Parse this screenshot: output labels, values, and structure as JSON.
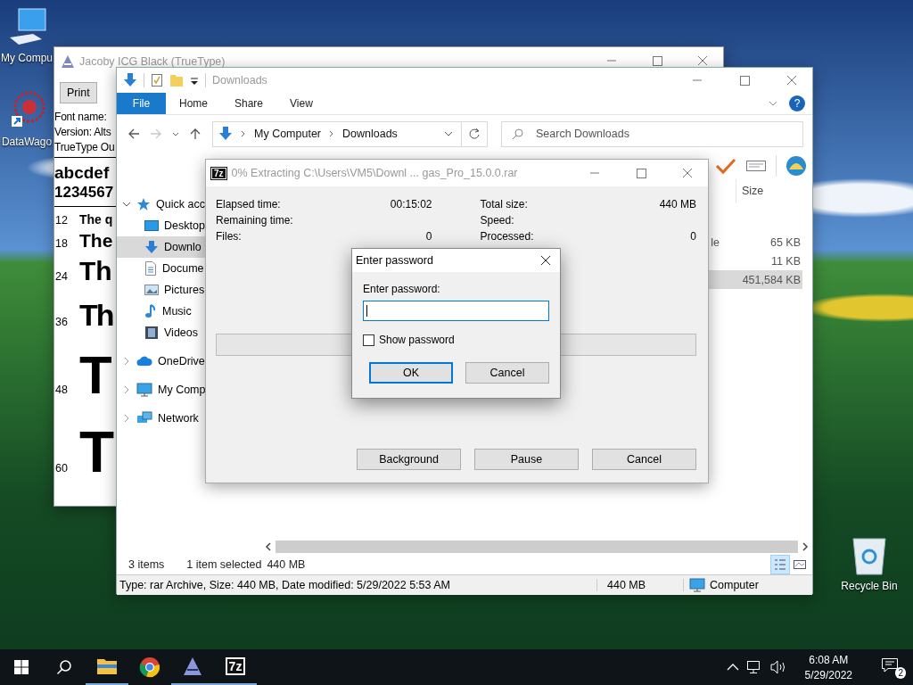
{
  "desktop": {
    "icons": [
      {
        "kind": "computer",
        "label": "My Compu"
      },
      {
        "kind": "starburst",
        "label": "DataWago"
      },
      {
        "kind": "recycle",
        "label": "Recycle Bin"
      }
    ]
  },
  "font_viewer": {
    "title": "Jacoby ICG Black (TrueType)",
    "buttons": [
      "Print"
    ],
    "info": [
      "Font name:",
      "Version: Alts",
      "TrueType Ou"
    ],
    "alphabet": "abcdef",
    "digits": "1234567",
    "samples": [
      {
        "size": "12",
        "text": "The q"
      },
      {
        "size": "18",
        "text": "The"
      },
      {
        "size": "24",
        "text": "Th"
      },
      {
        "size": "36",
        "text": "Th"
      },
      {
        "size": "48",
        "text": "T"
      },
      {
        "size": "60",
        "text": "T"
      }
    ]
  },
  "explorer": {
    "title": "Downloads",
    "ribbon_tabs": [
      {
        "label": "File",
        "kind": "menu"
      },
      {
        "label": "Home",
        "kind": "tab"
      },
      {
        "label": "Share",
        "kind": "tab"
      },
      {
        "label": "View",
        "kind": "tab"
      }
    ],
    "help": "?",
    "breadcrumb": [
      "My Computer",
      "Downloads"
    ],
    "search": {
      "placeholder": "Search Downloads"
    },
    "nav": [
      {
        "label": "Quick acc",
        "kind": "star",
        "expanded": true,
        "selected": false,
        "children": [
          {
            "label": "Desktop",
            "kind": "desktop",
            "selected": false
          },
          {
            "label": "Downlo",
            "kind": "download",
            "selected": true
          },
          {
            "label": "Docume",
            "kind": "document",
            "selected": false
          },
          {
            "label": "Pictures",
            "kind": "pictures",
            "selected": false
          },
          {
            "label": "Music",
            "kind": "music",
            "selected": false
          },
          {
            "label": "Videos",
            "kind": "videos",
            "selected": false
          }
        ]
      },
      {
        "label": "OneDrive",
        "kind": "cloud",
        "expanded": false,
        "selected": false
      },
      {
        "label": "My Comp",
        "kind": "computer",
        "expanded": false,
        "selected": false
      },
      {
        "label": "Network",
        "kind": "network",
        "expanded": false,
        "selected": false
      }
    ],
    "columns": [
      "Size"
    ],
    "rows": [
      {
        "column_1": "le",
        "size": "65 KB",
        "selected": false
      },
      {
        "size": "11 KB",
        "selected": false
      },
      {
        "size": "451,584 KB",
        "selected": true
      }
    ],
    "status": {
      "items": "3 items",
      "selection": "1 item selected",
      "selection_size": "440 MB"
    },
    "details_bar": {
      "description": "Type: rar Archive, Size: 440 MB, Date modified: 5/29/2022 5:53 AM",
      "size": "440 MB",
      "zone": "Computer"
    }
  },
  "extract": {
    "badge": "7z",
    "title": "0% Extracting C:\\Users\\VM5\\Downl ... gas_Pro_15.0.0.rar",
    "stats_left": [
      {
        "label": "Elapsed time:",
        "value": "00:15:02"
      },
      {
        "label": "Remaining time:"
      },
      {
        "label": "Files:",
        "value": "0"
      }
    ],
    "stats_right": [
      {
        "label": "Total size:",
        "value": "440 MB"
      },
      {
        "label": "Speed:"
      },
      {
        "label": "Processed:",
        "value": "0"
      }
    ],
    "progress": {
      "level": 0
    },
    "buttons": [
      "Background",
      "Pause",
      "Cancel"
    ]
  },
  "password": {
    "title": "Enter password",
    "label": "Enter password:",
    "show_password": {
      "label": "Show password",
      "checked": false
    },
    "buttons": [
      {
        "label": "OK",
        "focused": true
      },
      {
        "label": "Cancel",
        "focused": false
      }
    ]
  },
  "taskbar": {
    "apps": [
      {
        "kind": "start",
        "running": false
      },
      {
        "kind": "search",
        "running": false
      },
      {
        "kind": "explorer",
        "running": true
      },
      {
        "kind": "browser",
        "running": false
      },
      {
        "kind": "fontviewer",
        "running": true
      },
      {
        "kind": "archiver",
        "running": true,
        "label": "7z"
      }
    ],
    "time": "6:08 AM",
    "date": "5/29/2022",
    "notifications": "2"
  }
}
